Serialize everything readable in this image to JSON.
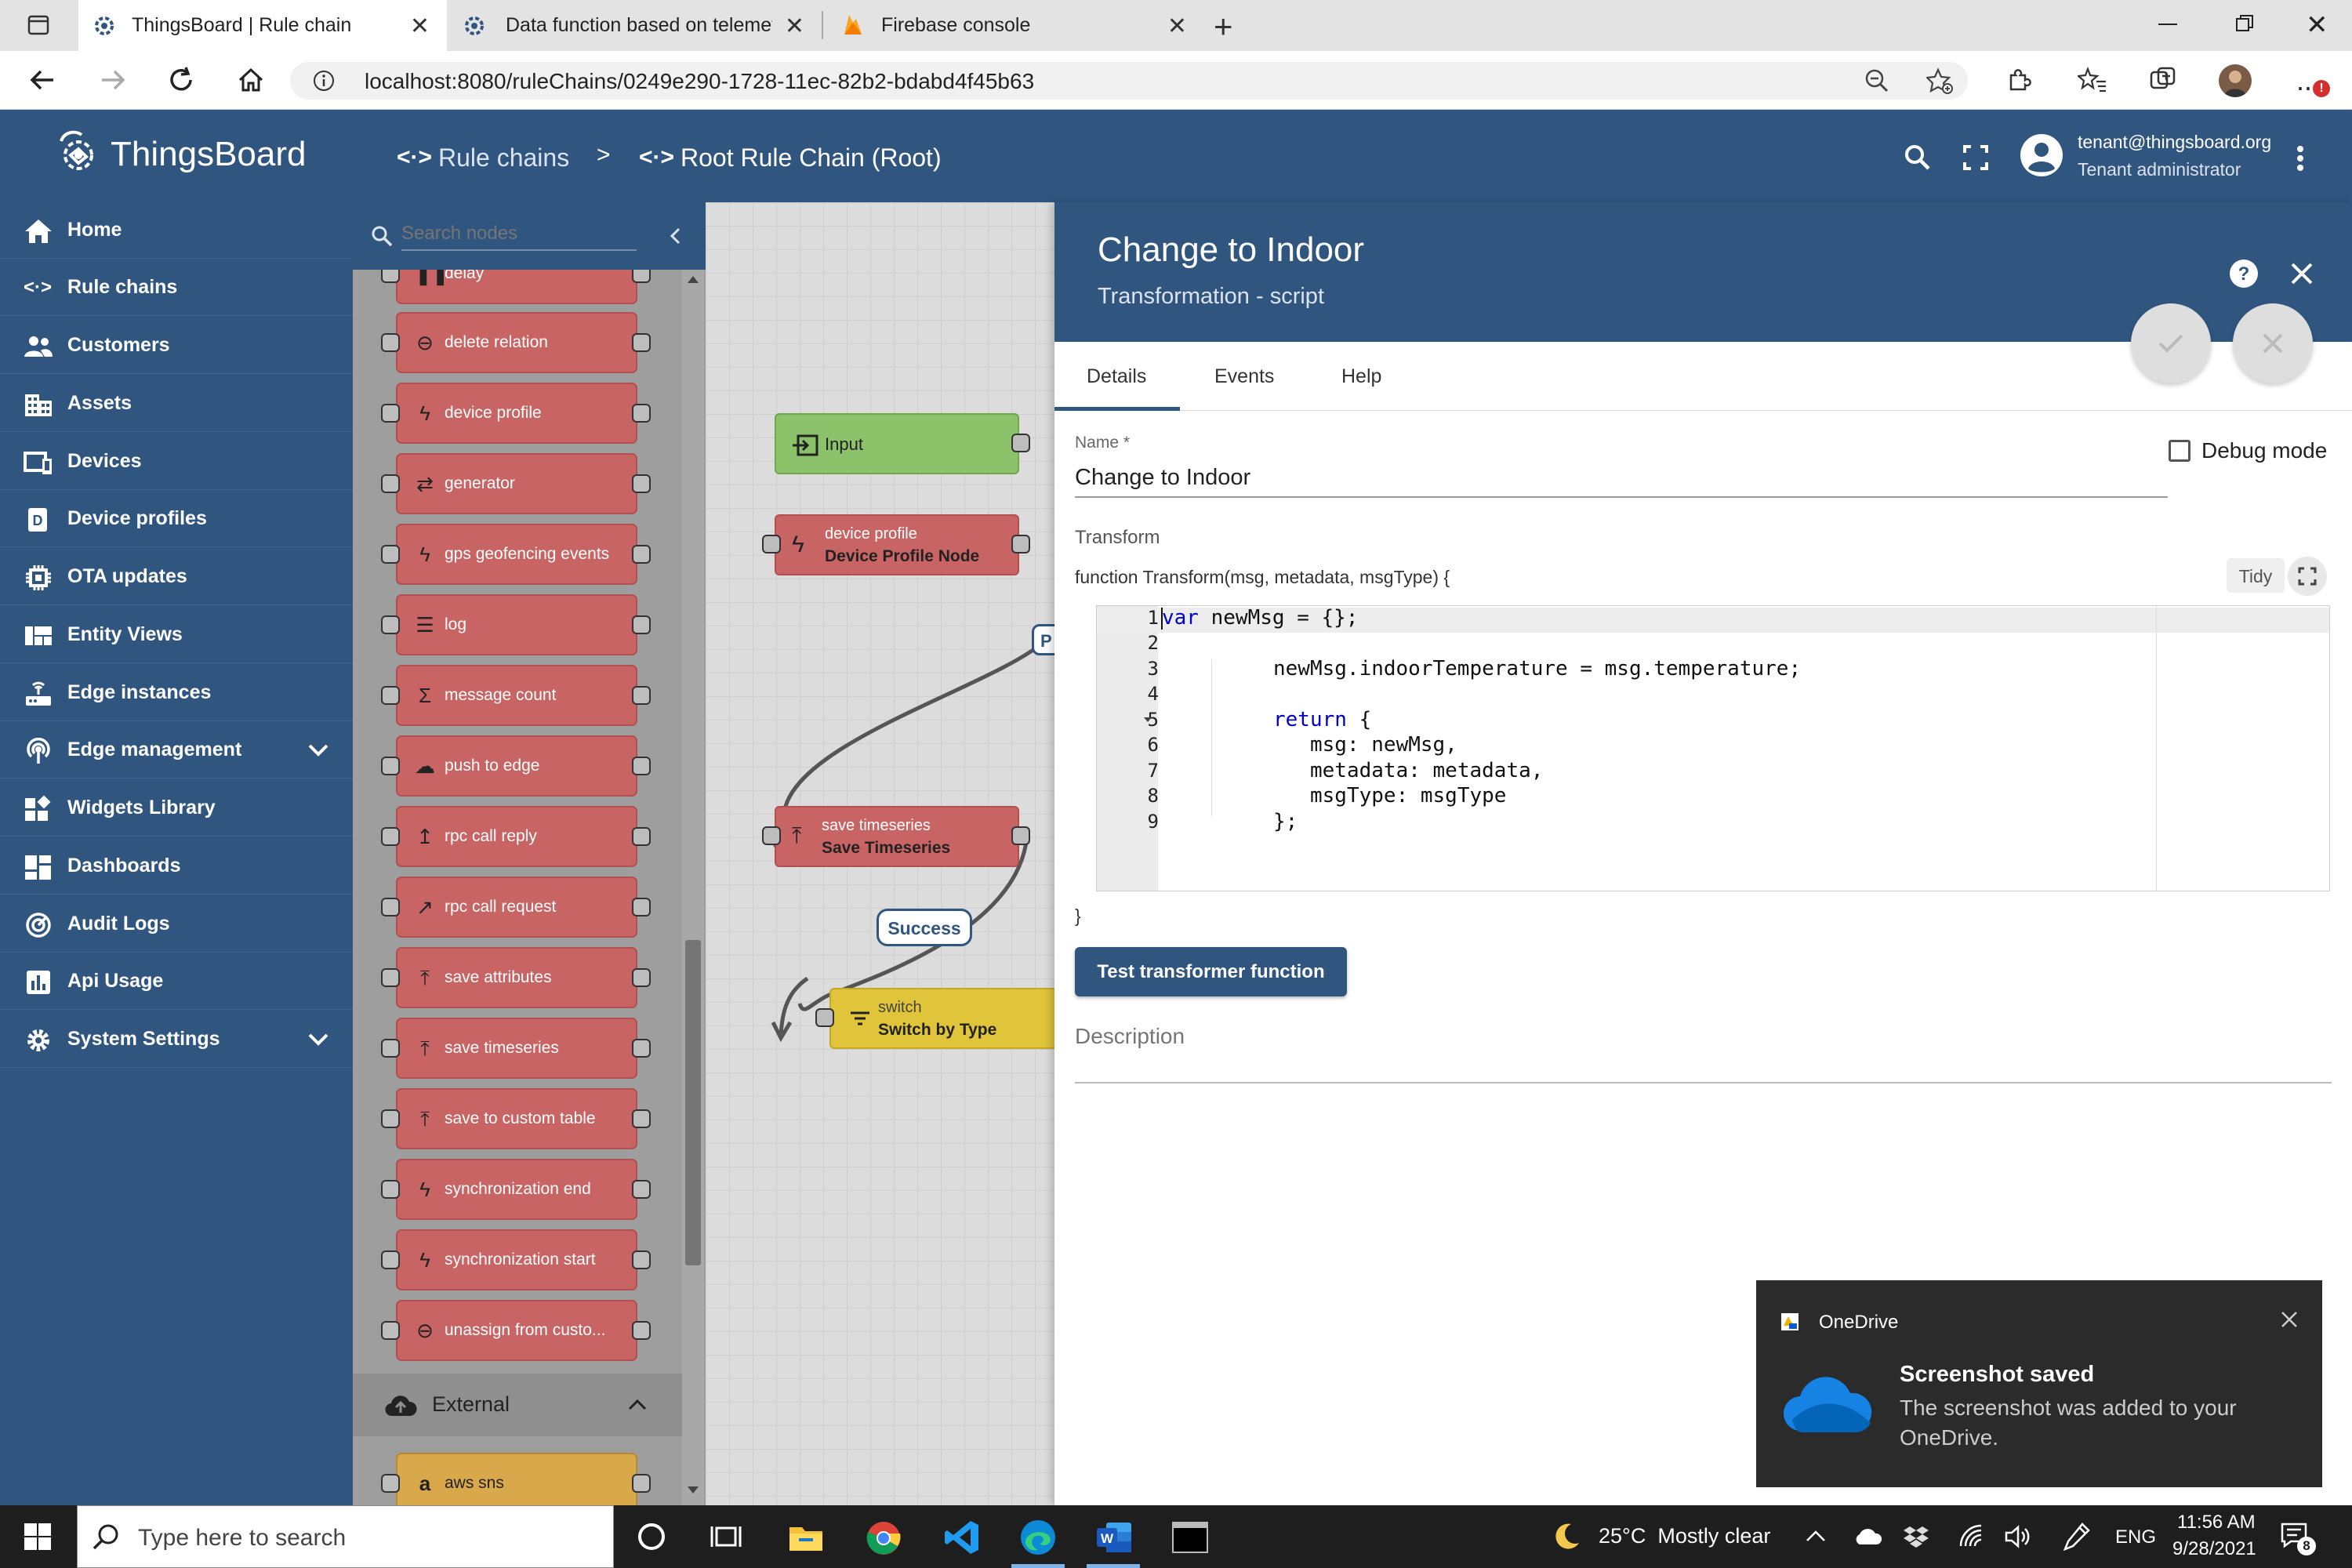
{
  "browser": {
    "tabs": [
      {
        "title": "ThingsBoard | Rule chain",
        "active": true
      },
      {
        "title": "Data function based on telemetr",
        "active": false
      },
      {
        "title": "Firebase console",
        "active": false
      }
    ],
    "url": "localhost:8080/ruleChains/0249e290-1728-11ec-82b2-bdabd4f45b63"
  },
  "app": {
    "logo": "ThingsBoard",
    "breadcrumb": {
      "first": "Rule chains",
      "separator": ">",
      "second": "Root Rule Chain (Root)"
    },
    "user": {
      "email": "tenant@thingsboard.org",
      "role": "Tenant administrator"
    },
    "colors": {
      "primary": "#305680",
      "node_action": "#c86464",
      "node_input": "#8bc26a",
      "node_filter": "#e0c43a"
    }
  },
  "sidebar": {
    "items": [
      {
        "label": "Home",
        "icon": "home-icon"
      },
      {
        "label": "Rule chains",
        "icon": "rule-chain-icon"
      },
      {
        "label": "Customers",
        "icon": "people-icon"
      },
      {
        "label": "Assets",
        "icon": "domain-icon"
      },
      {
        "label": "Devices",
        "icon": "devices-icon"
      },
      {
        "label": "Device profiles",
        "icon": "device-profile-icon"
      },
      {
        "label": "OTA updates",
        "icon": "memory-icon"
      },
      {
        "label": "Entity Views",
        "icon": "view-quilt-icon"
      },
      {
        "label": "Edge instances",
        "icon": "router-icon"
      },
      {
        "label": "Edge management",
        "icon": "settings-input-antenna-icon"
      },
      {
        "label": "Widgets Library",
        "icon": "widgets-icon"
      },
      {
        "label": "Dashboards",
        "icon": "dashboard-icon"
      },
      {
        "label": "Audit Logs",
        "icon": "track-changes-icon"
      },
      {
        "label": "Api Usage",
        "icon": "insert-chart-icon"
      },
      {
        "label": "System Settings",
        "icon": "settings-icon"
      }
    ]
  },
  "library": {
    "search_placeholder": "Search nodes",
    "nodes": [
      "delay",
      "delete relation",
      "device profile",
      "generator",
      "gps geofencing events",
      "log",
      "message count",
      "push to edge",
      "rpc call reply",
      "rpc call request",
      "save attributes",
      "save timeseries",
      "save to custom table",
      "synchronization end",
      "synchronization start",
      "unassign from custo..."
    ],
    "section": "External",
    "external_nodes": [
      "aws sns"
    ]
  },
  "canvas": {
    "input_label": "Input",
    "node1_type": "device profile",
    "node1_name": "Device Profile Node",
    "node2_type": "save timeseries",
    "node2_name": "Save Timeseries",
    "edge_label": "Success",
    "node3_type": "switch",
    "node3_name": "Switch by Type",
    "partial_label": "P"
  },
  "panel": {
    "title": "Change to Indoor",
    "subtitle": "Transformation - script",
    "tabs": [
      "Details",
      "Events",
      "Help"
    ],
    "name_label": "Name *",
    "name_value": "Change to Indoor",
    "debug_label": "Debug mode",
    "transform_label": "Transform",
    "function_signature": "function Transform(msg, metadata, msgType) {",
    "tidy_label": "Tidy",
    "closing_brace": "}",
    "test_button": "Test transformer function",
    "description_placeholder": "Description",
    "code": {
      "line_numbers": [
        "1",
        "2",
        "3",
        "4",
        "5",
        "6",
        "7",
        "8",
        "9"
      ],
      "l1_kw": "var",
      "l1_rest": " newMsg = {};",
      "l3": "newMsg.indoorTemperature = msg.temperature;",
      "l5_kw": "return",
      "l5_rest": " {",
      "l6": "msg: newMsg,",
      "l7": "metadata: metadata,",
      "l8": "msgType: msgType",
      "l9": "};"
    }
  },
  "toast": {
    "app": "OneDrive",
    "title": "Screenshot saved",
    "body": "The screenshot was added to your OneDrive."
  },
  "taskbar": {
    "search_placeholder": "Type here to search",
    "weather": "25°C  Mostly clear",
    "language": "ENG",
    "time": "11:56 AM",
    "date": "9/28/2021",
    "notification_count": "8"
  }
}
